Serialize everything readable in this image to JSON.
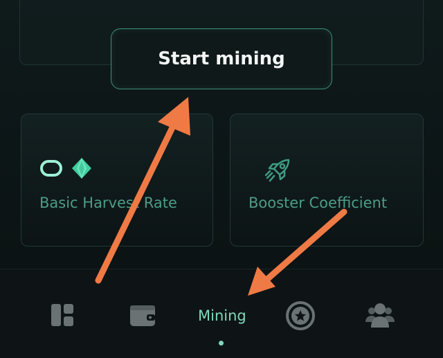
{
  "start_button": {
    "label": "Start mining"
  },
  "cards": [
    {
      "label": "Basic Harvest Rate",
      "icons": [
        "toggle-pill-icon",
        "diamond-gem-icon"
      ]
    },
    {
      "label": "Booster Coefficient",
      "icons": [
        "rocket-icon"
      ]
    }
  ],
  "nav": {
    "items": [
      {
        "icon": "dashboard-icon"
      },
      {
        "icon": "wallet-icon"
      },
      {
        "label": "Mining",
        "active": true
      },
      {
        "icon": "star-badge-icon"
      },
      {
        "icon": "team-icon"
      }
    ]
  },
  "colors": {
    "accent": "#7fd8bc",
    "label_green": "#4c9d86",
    "arrow": "#f07a45",
    "background": "#0d1516"
  }
}
